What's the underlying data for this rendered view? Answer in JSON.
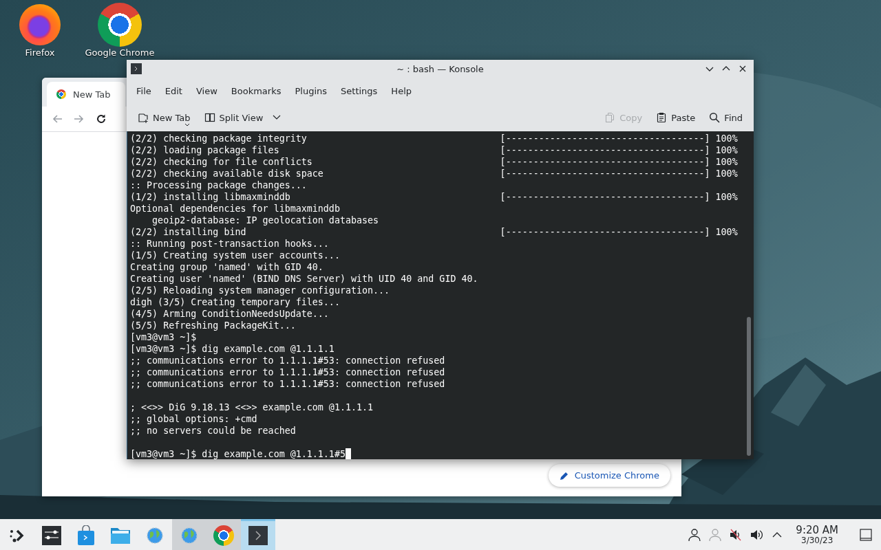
{
  "desktop": {
    "icons": [
      {
        "label": "Firefox",
        "kind": "firefox"
      },
      {
        "label": "Google Chrome",
        "kind": "chrome"
      }
    ]
  },
  "browser": {
    "tab": {
      "label": "New Tab",
      "selected": true
    },
    "nav": [
      {
        "kind": "back",
        "disabled": true
      },
      {
        "kind": "forward",
        "disabled": true
      },
      {
        "kind": "reload",
        "disabled": false
      }
    ],
    "customize_button": "Customize Chrome"
  },
  "konsole": {
    "title": "~ : bash — Konsole",
    "menu": [
      "File",
      "Edit",
      "View",
      "Bookmarks",
      "Plugins",
      "Settings",
      "Help"
    ],
    "toolbar_left": [
      {
        "kind": "new-tab",
        "label": "New Tab",
        "disabled": false
      },
      {
        "kind": "split-view",
        "label": "Split View",
        "disabled": false
      }
    ],
    "toolbar_right": [
      {
        "kind": "copy",
        "label": "Copy",
        "disabled": true
      },
      {
        "kind": "paste",
        "label": "Paste",
        "disabled": false
      },
      {
        "kind": "find",
        "label": "Find",
        "disabled": false
      }
    ],
    "blocks": [
      [
        {
          "text": "(2/2) checking package integrity",
          "bar": "[------------------------------------] 100%"
        },
        {
          "text": "(2/2) loading package files",
          "bar": "[------------------------------------] 100%"
        },
        {
          "text": "(2/2) checking for file conflicts",
          "bar": "[------------------------------------] 100%"
        },
        {
          "text": "(2/2) checking available disk space",
          "bar": "[------------------------------------] 100%"
        },
        {
          "text": ":: Processing package changes..."
        },
        {
          "text": "(1/2) installing libmaxminddb",
          "bar": "[------------------------------------] 100%"
        },
        {
          "text": "Optional dependencies for libmaxminddb"
        },
        {
          "text": "    geoip2-database: IP geolocation databases"
        },
        {
          "text": "(2/2) installing bind",
          "bar": "[------------------------------------] 100%"
        },
        {
          "text": ":: Running post-transaction hooks..."
        },
        {
          "text": "(1/5) Creating system user accounts..."
        },
        {
          "text": "Creating group 'named' with GID 40."
        },
        {
          "text": "Creating user 'named' (BIND DNS Server) with UID 40 and GID 40."
        },
        {
          "text": "(2/5) Reloading system manager configuration..."
        },
        {
          "text": "digh (3/5) Creating temporary files..."
        },
        {
          "text": "(4/5) Arming ConditionNeedsUpdate..."
        },
        {
          "text": "(5/5) Refreshing PackageKit..."
        },
        {
          "text": "[vm3@vm3 ~]$"
        },
        {
          "text": "[vm3@vm3 ~]$ dig example.com @1.1.1.1"
        },
        {
          "text": ";; communications error to 1.1.1.1#53: connection refused"
        },
        {
          "text": ";; communications error to 1.1.1.1#53: connection refused"
        },
        {
          "text": ";; communications error to 1.1.1.1#53: connection refused"
        }
      ],
      [
        {
          "text": "; <<>> DiG 9.18.13 <<>> example.com @1.1.1.1"
        },
        {
          "text": ";; global options: +cmd"
        },
        {
          "text": ";; no servers could be reached"
        }
      ],
      [
        {
          "text": "[vm3@vm3 ~]$ dig example.com @1.1.1.1#5"
        }
      ]
    ]
  },
  "taskbar": {
    "tasks": [
      {
        "kind": "launcher",
        "open": false,
        "selected": false
      },
      {
        "kind": "sliders",
        "open": false,
        "selected": false
      },
      {
        "kind": "bag",
        "open": false,
        "selected": false
      },
      {
        "kind": "folder",
        "open": false,
        "selected": false
      },
      {
        "kind": "globe",
        "open": false,
        "selected": false
      },
      {
        "kind": "globe",
        "open": true,
        "selected": false
      },
      {
        "kind": "chrome",
        "open": true,
        "selected": false
      },
      {
        "kind": "terminal",
        "open": true,
        "selected": true
      }
    ],
    "tray": [
      {
        "kind": "user",
        "disabled": false
      },
      {
        "kind": "user",
        "disabled": true
      },
      {
        "kind": "muted",
        "disabled": false
      },
      {
        "kind": "speaker",
        "disabled": false
      },
      {
        "kind": "caret",
        "disabled": false
      }
    ],
    "clock": {
      "time": "9:20 AM",
      "date": "3/30/23"
    }
  }
}
